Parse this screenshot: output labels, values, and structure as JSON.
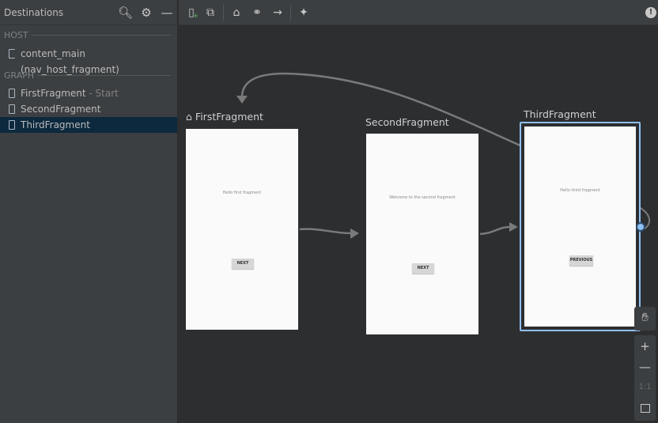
{
  "sidebar": {
    "title": "Destinations",
    "host_label": "HOST",
    "host_item": "content_main (nav_host_fragment)",
    "graph_label": "GRAPH",
    "items": [
      {
        "label": "FirstFragment",
        "suffix": " - Start"
      },
      {
        "label": "SecondFragment",
        "suffix": ""
      },
      {
        "label": "ThirdFragment",
        "suffix": ""
      }
    ]
  },
  "canvas": {
    "fragments": [
      {
        "title": "FirstFragment",
        "text": "Hello first fragment",
        "button": "NEXT",
        "start": true
      },
      {
        "title": "SecondFragment",
        "text": "Welcome to the second fragment",
        "button": "NEXT"
      },
      {
        "title": "ThirdFragment",
        "text": "Hello third fragment",
        "button": "PREVIOUS",
        "selected": true
      }
    ],
    "zoom_actual_label": "1:1"
  },
  "colors": {
    "selection": "#8fc1f2",
    "arrow": "#7a7a7a",
    "selected_row": "#0d293e"
  }
}
